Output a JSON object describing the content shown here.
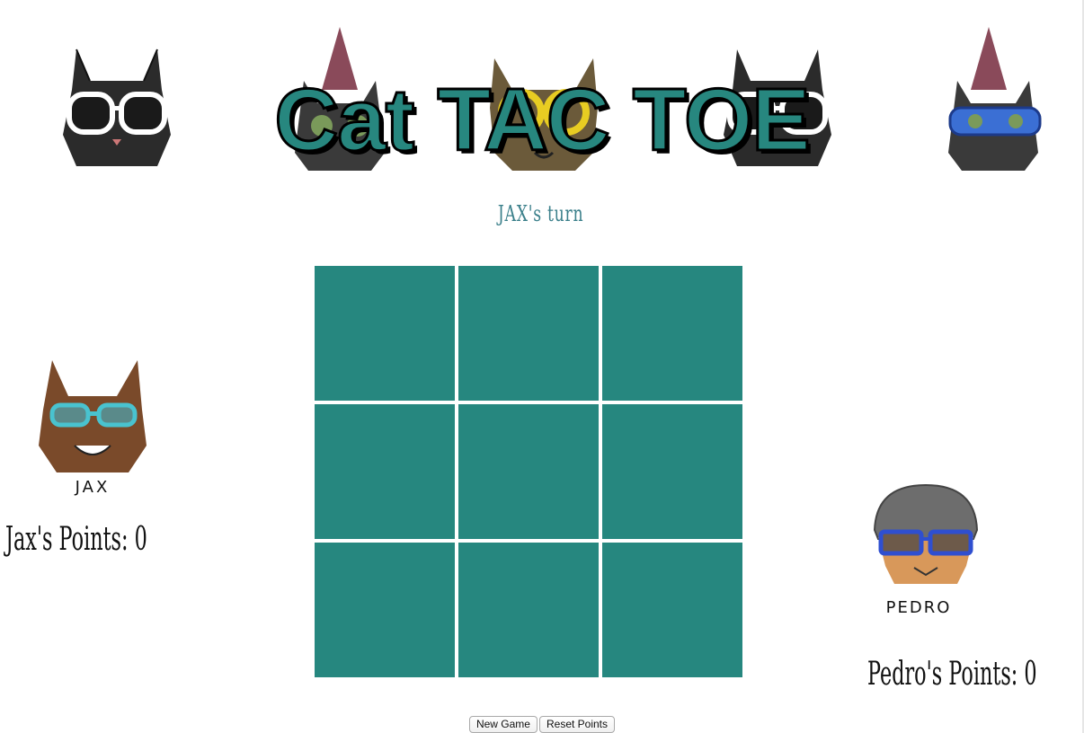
{
  "title": "Cat TAC TOE",
  "turn_text": "JAX's turn",
  "header_cats": [
    {
      "icon": "cat-white-sunglasses-icon"
    },
    {
      "icon": "cat-party-hat-icon"
    },
    {
      "icon": "cat-tabby-yellow-glasses-icon"
    },
    {
      "icon": "cat-white-sunglasses-icon"
    },
    {
      "icon": "cat-party-hat-blue-glasses-icon"
    }
  ],
  "board": {
    "cells": [
      "",
      "",
      "",
      "",
      "",
      "",
      "",
      "",
      ""
    ],
    "cell_color": "#26877f"
  },
  "players": {
    "jax": {
      "name_label": "JAX",
      "points_label": "Jax's Points: 0",
      "icon": "cat-jax-goggles-icon"
    },
    "pedro": {
      "name_label": "PEDRO",
      "points_label": "Pedro's Points: 0",
      "icon": "cat-pedro-beanie-icon"
    }
  },
  "buttons": {
    "new_game": "New Game",
    "reset_points": "Reset Points"
  },
  "colors": {
    "accent": "#26877f",
    "turn_text": "#3a7f8a"
  }
}
